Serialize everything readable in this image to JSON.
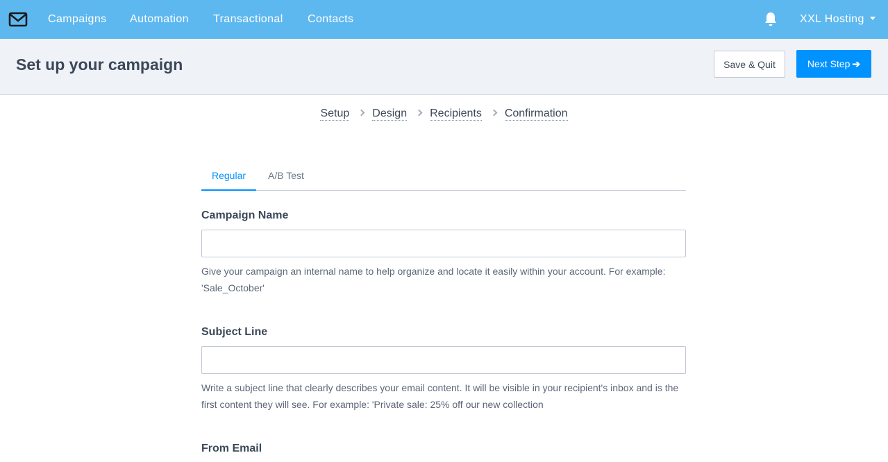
{
  "nav": {
    "items": [
      "Campaigns",
      "Automation",
      "Transactional",
      "Contacts"
    ],
    "account": "XXL Hosting"
  },
  "header": {
    "title": "Set up your campaign",
    "save_quit": "Save & Quit",
    "next_step": "Next Step"
  },
  "steps": [
    "Setup",
    "Design",
    "Recipients",
    "Confirmation"
  ],
  "tabs": [
    "Regular",
    "A/B Test"
  ],
  "form": {
    "campaign_name": {
      "label": "Campaign Name",
      "value": "",
      "help": "Give your campaign an internal name to help organize and locate it easily within your account. For example: 'Sale_October'"
    },
    "subject_line": {
      "label": "Subject Line",
      "value": "",
      "help": "Write a subject line that clearly describes your email content. It will be visible in your recipient's inbox and is the first content they will see. For example: 'Private sale: 25% off our new collection"
    },
    "from_email": {
      "label": "From Email"
    }
  },
  "colors": {
    "nav_bg": "#5eb8f0",
    "primary": "#0092ff",
    "header_bg": "#eff2f7"
  }
}
